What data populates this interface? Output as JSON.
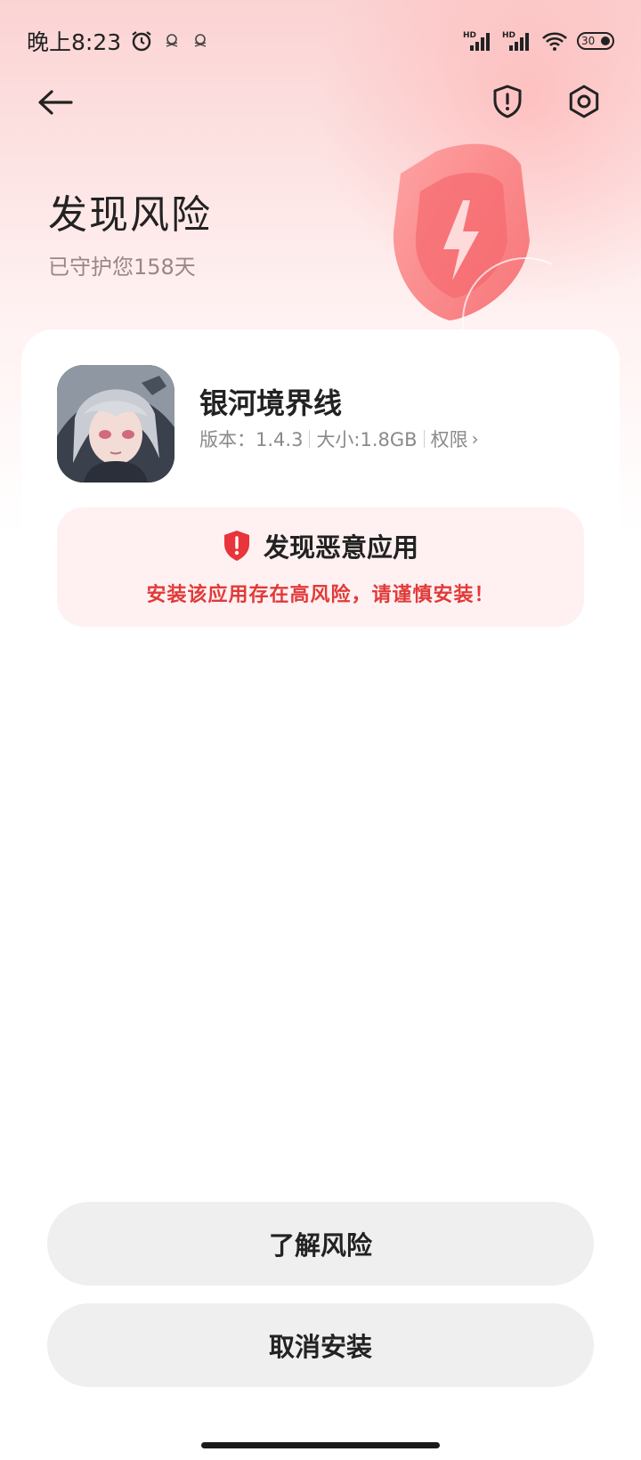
{
  "status_bar": {
    "time": "晚上8:23",
    "battery": "30",
    "icons": [
      "alarm-icon",
      "notification-icon",
      "notification-icon",
      "hd-signal-icon",
      "hd-signal-icon",
      "wifi-icon",
      "battery-icon"
    ]
  },
  "nav": {
    "back_icon": "back-arrow-icon",
    "alert_icon": "shield-alert-icon",
    "settings_icon": "settings-icon"
  },
  "header": {
    "title": "发现风险",
    "subtitle": "已守护您158天"
  },
  "app": {
    "name": "银河境界线",
    "version": "版本：1.4.3",
    "size": "大小:1.8GB",
    "permissions": "权限"
  },
  "warning": {
    "title": "发现恶意应用",
    "description": "安装该应用存在高风险，请谨慎安装！"
  },
  "buttons": {
    "learn_risk": "了解风险",
    "cancel_install": "取消安装"
  },
  "colors": {
    "accent_red": "#e13a3a",
    "warning_bg": "#fff1f1",
    "button_bg": "#efefef"
  }
}
